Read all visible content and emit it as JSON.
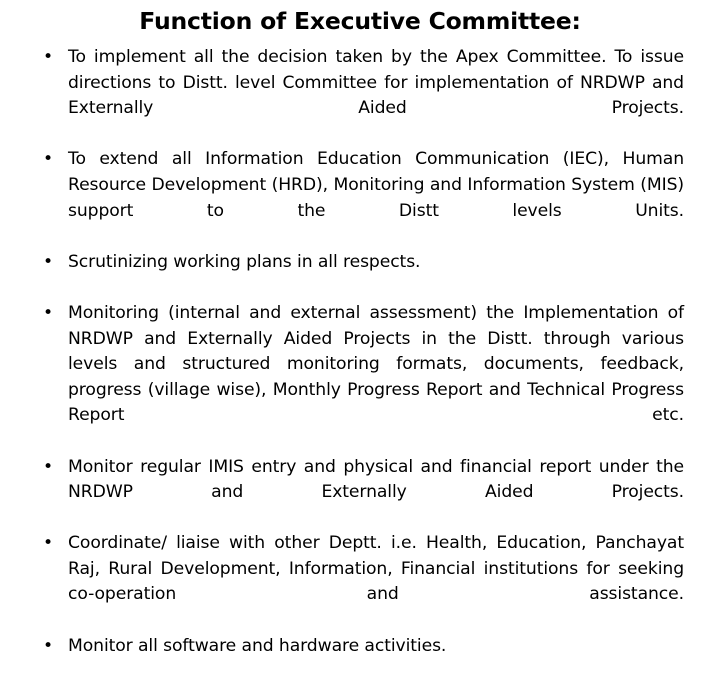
{
  "slide": {
    "title": "Function of Executive Committee:",
    "background_color": "#ffffff",
    "text_color": "#000000",
    "bullet_marker": "•",
    "bullets": [
      {
        "id": "bullet-implement-apex-decisions",
        "text": "To implement all the decision taken by the Apex Committee. To issue directions to Distt. level Committee for implementation of NRDWP  and Externally Aided Projects."
      },
      {
        "id": "bullet-extend-iec-hrd-mis",
        "text": "To extend all Information Education Communication (IEC), Human Resource Development (HRD), Monitoring and Information System (MIS) support to the Distt levels Units."
      },
      {
        "id": "bullet-scrutinizing-working-plans",
        "text": "Scrutinizing working plans in all respects."
      },
      {
        "id": "bullet-monitoring-implementation",
        "text": "Monitoring (internal and external assessment) the Implementation of NRDWP and Externally Aided Projects in the Distt. through various levels and structured monitoring formats, documents, feedback, progress (village wise), Monthly Progress Report and Technical Progress Report etc."
      },
      {
        "id": "bullet-monitor-imis-entry",
        "text": "Monitor regular IMIS entry and physical and financial report under the NRDWP and Externally Aided Projects."
      },
      {
        "id": "bullet-coordinate-liaise-depts",
        "text": "Coordinate/ liaise with other Deptt. i.e. Health, Education, Panchayat Raj, Rural Development, Information, Financial institutions for seeking co-operation and assistance."
      },
      {
        "id": "bullet-monitor-software-hardware",
        "text": "Monitor all software and hardware activities."
      }
    ]
  }
}
